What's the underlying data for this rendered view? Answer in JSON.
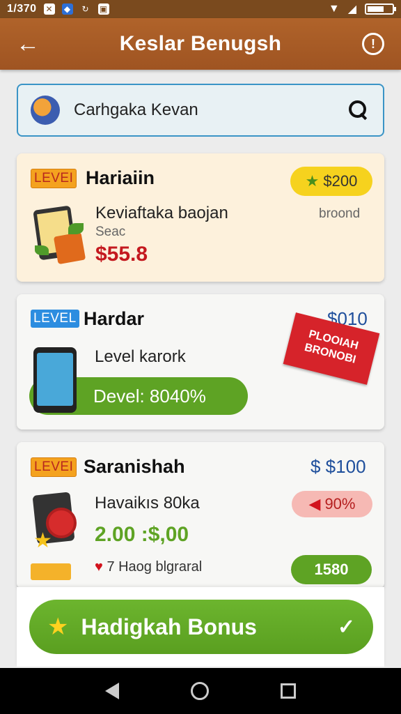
{
  "status_bar": {
    "time": "1/370",
    "icons": [
      "x-square-icon",
      "dropbox-icon",
      "sync-icon",
      "lock-icon"
    ],
    "right_icons": [
      "wifi-icon",
      "signal-icon",
      "battery-icon"
    ]
  },
  "app_bar": {
    "title": "Keslar Benugsh",
    "back_icon": "arrow-left-icon",
    "info_icon": "info-icon"
  },
  "search": {
    "value": "Carhgaka Kevan"
  },
  "cards": [
    {
      "badge": "LEVEI",
      "title": "Hariaiin",
      "points": "$200",
      "subtitle": "Keviaftaka baojan",
      "tag": "broond",
      "label": "Seac",
      "price": "$55.8"
    },
    {
      "badge": "LEVEL",
      "title": "Hardar",
      "points": "$010",
      "subtitle": "Level karork",
      "progress_label": "Devel: 8040%",
      "ribbon_text": "PLOOIAH BRONOBI"
    },
    {
      "badge": "LEVEI",
      "title": "Saranishah",
      "points": "$ $100",
      "subtitle": "Havaikıs 80ka",
      "discount": "90%",
      "price": "2.00 :$,00",
      "note": "7 Haog blgraral",
      "badge_value": "1580"
    }
  ],
  "bonus_button": {
    "label": "Hadigkah Bonus"
  },
  "colors": {
    "app_bar": "#a95b25",
    "accent_green": "#5ea324",
    "price_red": "#c4191f",
    "badge_orange": "#f4a21f",
    "badge_blue": "#2c8de0"
  }
}
